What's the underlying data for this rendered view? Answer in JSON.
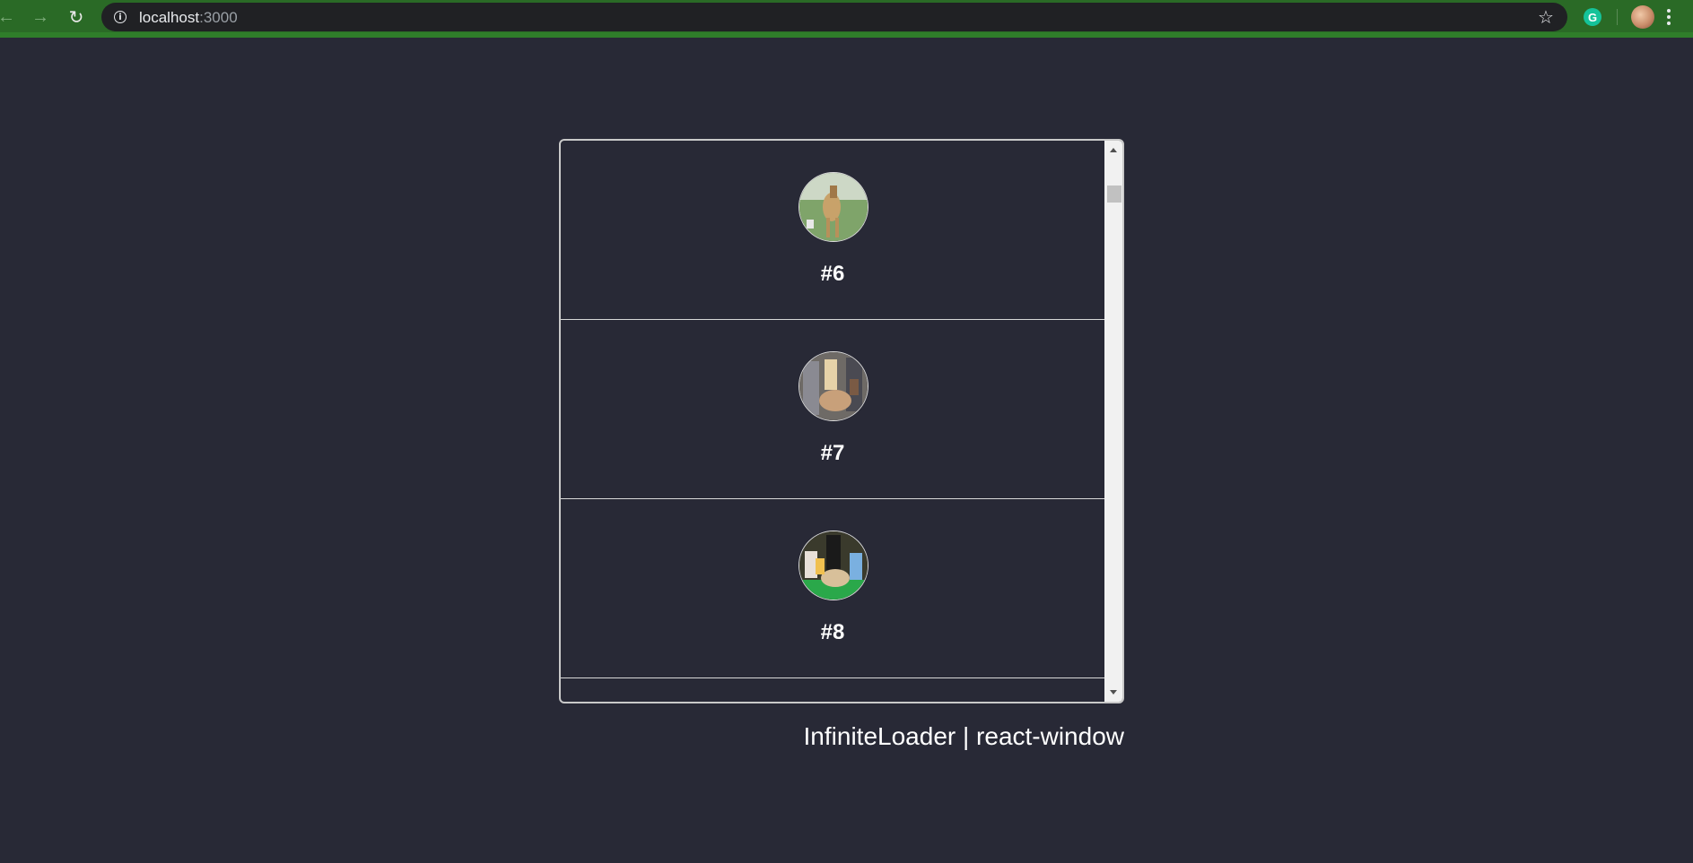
{
  "browser": {
    "url_host": "localhost",
    "url_port": ":3000",
    "back_icon": "arrow-left-icon",
    "forward_icon": "arrow-right-icon",
    "reload_icon": "reload-icon",
    "info_icon": "info-icon",
    "star_icon": "star-icon",
    "extension_letter": "G",
    "menu_icon": "kebab-menu-icon"
  },
  "list": {
    "items": [
      {
        "label": "#6",
        "image": "dog-photo-avatar"
      },
      {
        "label": "#7",
        "image": "dog-photo-avatar"
      },
      {
        "label": "#8",
        "image": "dog-photo-avatar"
      }
    ]
  },
  "caption": "InfiniteLoader | react-window",
  "colors": {
    "background": "#282936",
    "toolbar": "#2a6a26",
    "text": "#ffffff"
  }
}
